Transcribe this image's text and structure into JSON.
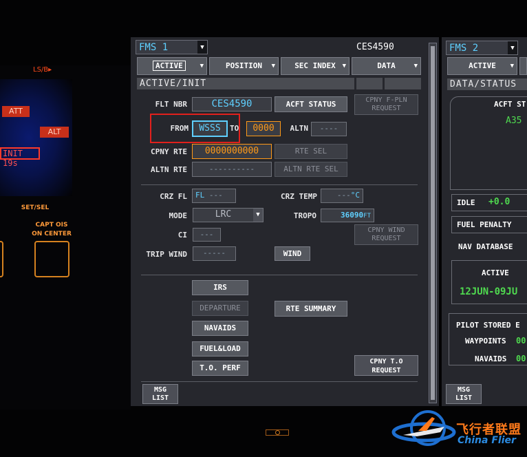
{
  "left_panel": {
    "ls_label": "LS/B▸",
    "ann_att": "ATT",
    "ann_alt": "ALT",
    "ann_init": "INIT 19s",
    "set_sel": "SET/SEL",
    "capt_ois": "CAPT OIS",
    "on_center": "ON CENTER"
  },
  "fms1": {
    "selector": "FMS 1",
    "flight_id": "CES4590",
    "nav": {
      "active": "ACTIVE",
      "position": "POSITION",
      "sec_index": "SEC INDEX",
      "data": "DATA"
    },
    "page_title": "ACTIVE/INIT",
    "flt_nbr_label": "FLT NBR",
    "flt_nbr_value": "CES4590",
    "acft_status_button": "ACFT STATUS",
    "cpny_fpln_request_line1": "CPNY F-PLN",
    "cpny_fpln_request_line2": "REQUEST",
    "from_label": "FROM",
    "from_value": "WSSS",
    "to_label": "TO",
    "to_value": "0000",
    "altn_label": "ALTN",
    "altn_value": "----",
    "cpny_rte_label": "CPNY RTE",
    "cpny_rte_value": "0000000000",
    "rte_sel_button": "RTE SEL",
    "altn_rte_label": "ALTN RTE",
    "altn_rte_value": "----------",
    "altn_rte_sel_button": "ALTN RTE SEL",
    "crz_fl_label": "CRZ FL",
    "crz_fl_prefix": "FL",
    "crz_fl_value": "---",
    "crz_temp_label": "CRZ TEMP",
    "crz_temp_value": "---",
    "crz_temp_unit": "°C",
    "mode_label": "MODE",
    "mode_value": "LRC",
    "tropo_label": "TROPO",
    "tropo_value": "36090",
    "tropo_unit": "FT",
    "ci_label": "CI",
    "ci_value": "---",
    "cpny_wind_request_line1": "CPNY WIND",
    "cpny_wind_request_line2": "REQUEST",
    "trip_wind_label": "TRIP WIND",
    "trip_wind_value": "-----",
    "wind_button": "WIND",
    "irs_button": "IRS",
    "departure_button": "DEPARTURE",
    "rte_summary_button": "RTE SUMMARY",
    "navaids_button": "NAVAIDS",
    "fuel_load_button": "FUEL&LOAD",
    "to_perf_button": "T.O. PERF",
    "cpny_to_request_line1": "CPNY T.O",
    "cpny_to_request_line2": "REQUEST",
    "msg_list_line1": "MSG",
    "msg_list_line2": "LIST"
  },
  "fms2": {
    "selector": "FMS 2",
    "nav_active": "ACTIVE",
    "page_title": "DATA/STATUS",
    "acft_status_partial": "ACFT ST",
    "model_partial": "A35",
    "idle_label": "IDLE",
    "idle_value": "+0.0",
    "fuel_penalty_label": "FUEL PENALTY",
    "nav_database_label": "NAV DATABASE",
    "active_label": "ACTIVE",
    "active_cycle": "12JUN-09JU",
    "pilot_stored_label": "PILOT STORED E",
    "waypoints_label": "WAYPOINTS",
    "waypoints_value": "00",
    "navaids_label": "NAVAIDS",
    "navaids_value": "00",
    "msg_list_line1": "MSG",
    "msg_list_line2": "LIST"
  },
  "watermark": {
    "cn_text": "飞行者联盟",
    "en_text": "China Flier"
  },
  "colors": {
    "cyan": "#5fd0ff",
    "green": "#4fd94f",
    "amber": "#ff9a18",
    "highlight_red": "#e2201c",
    "screen_bg": "#26272d"
  }
}
